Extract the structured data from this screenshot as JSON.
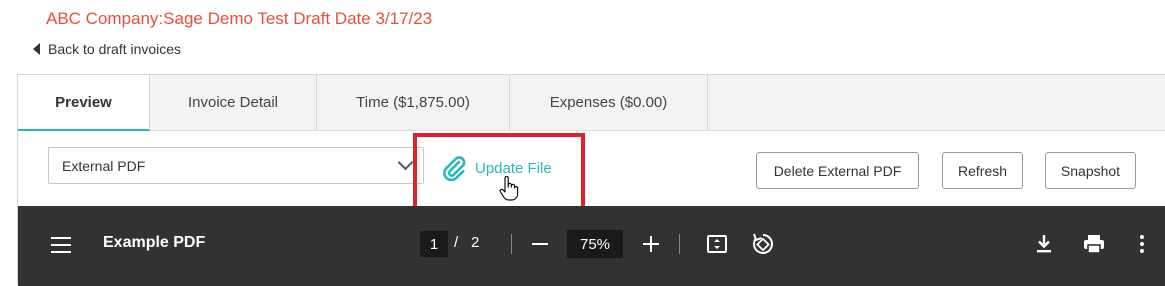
{
  "page": {
    "title": "ABC Company:Sage Demo Test Draft Date 3/17/23",
    "back_link": "Back to draft invoices"
  },
  "tabs": [
    {
      "label": "Preview",
      "active": true
    },
    {
      "label": "Invoice Detail",
      "active": false
    },
    {
      "label": "Time ($1,875.00)",
      "active": false
    },
    {
      "label": "Expenses ($0.00)",
      "active": false
    }
  ],
  "toolbar": {
    "file_select_value": "External PDF",
    "update_file_label": "Update File",
    "delete_button_label": "Delete External PDF",
    "refresh_button_label": "Refresh",
    "snapshot_button_label": "Snapshot"
  },
  "viewer": {
    "document_title": "Example PDF",
    "current_page": "1",
    "page_separator": "/",
    "total_pages": "2",
    "zoom_level": "75%"
  },
  "colors": {
    "title_red": "#e8503a",
    "accent_teal": "#29b8b8",
    "highlight_red": "#e0202a",
    "viewer_bg": "#323232"
  },
  "icons": [
    "caret-left-icon",
    "chevron-down-icon",
    "paperclip-icon",
    "hand-cursor-icon",
    "menu-icon",
    "zoom-out-icon",
    "zoom-in-icon",
    "fit-page-icon",
    "rotate-icon",
    "download-icon",
    "print-icon",
    "more-vertical-icon"
  ]
}
